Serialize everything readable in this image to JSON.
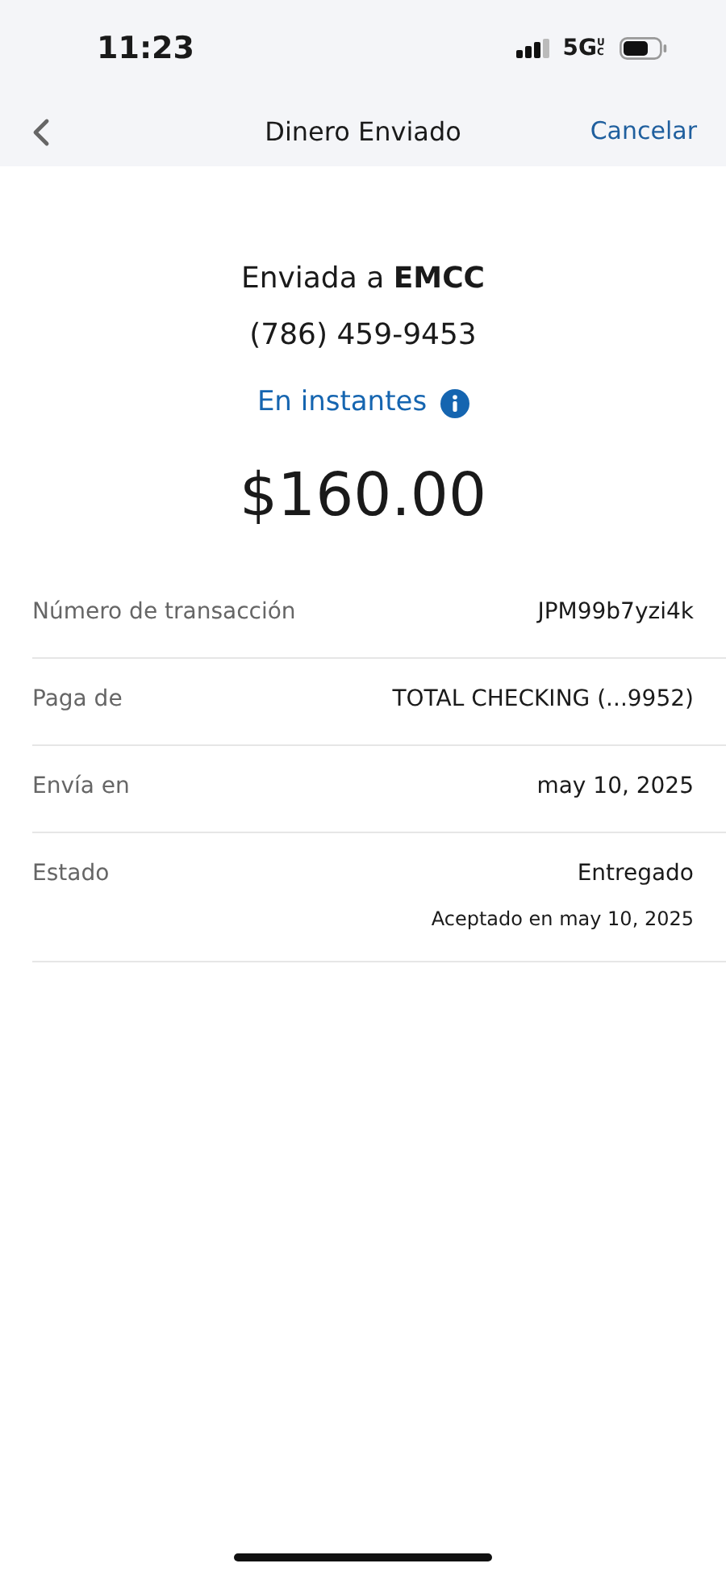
{
  "status_bar": {
    "time": "11:23",
    "network": "5G",
    "network_badge": "UC"
  },
  "nav": {
    "title": "Dinero Enviado",
    "action": "Cancelar"
  },
  "summary": {
    "recipient": "Enviada a **EMCC**",
    "phone": "(786) 459-9453",
    "speed": "En instantes",
    "amount": "$160.00"
  },
  "details": [
    {
      "label": "Número de transacción",
      "value": "JPM99b7yzi4k"
    },
    {
      "label": "Paga de",
      "value": "TOTAL CHECKING (...9952)"
    },
    {
      "label": "Envía en",
      "value": "may 10, 2025"
    },
    {
      "label": "Estado",
      "value": "Entregado",
      "note": "Aceptado en may 10, 2025"
    }
  ]
}
